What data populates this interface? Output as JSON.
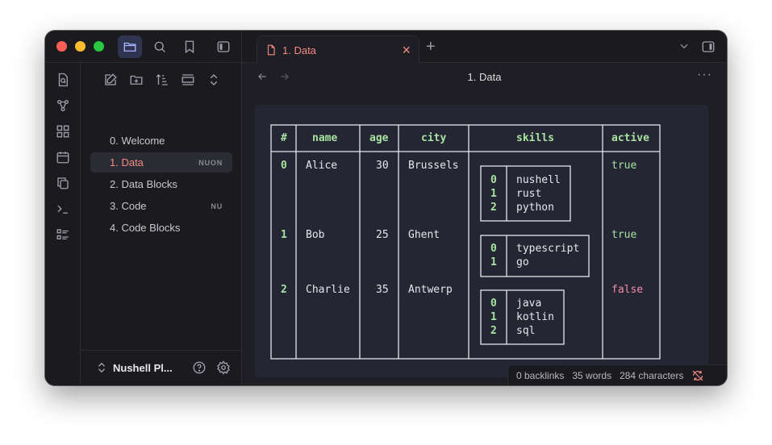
{
  "tab": {
    "label": "1. Data",
    "close": "×",
    "new": "+"
  },
  "main": {
    "title": "1. Data",
    "more": "···"
  },
  "sidebar": {
    "files": [
      {
        "label": "0. Welcome",
        "tag": ""
      },
      {
        "label": "1. Data",
        "tag": "NUON"
      },
      {
        "label": "2. Data Blocks",
        "tag": ""
      },
      {
        "label": "3. Code",
        "tag": "NU"
      },
      {
        "label": "4. Code Blocks",
        "tag": ""
      }
    ],
    "vault_name": "Nushell Pl..."
  },
  "table": {
    "headers": [
      "#",
      "name",
      "age",
      "city",
      "skills",
      "active"
    ],
    "rows": [
      {
        "index": "0",
        "name": "Alice",
        "age": "30",
        "city": "Brussels",
        "skills": [
          {
            "i": "0",
            "v": "nushell"
          },
          {
            "i": "1",
            "v": "rust"
          },
          {
            "i": "2",
            "v": "python"
          }
        ],
        "active": "true"
      },
      {
        "index": "1",
        "name": "Bob",
        "age": "25",
        "city": "Ghent",
        "skills": [
          {
            "i": "0",
            "v": "typescript"
          },
          {
            "i": "1",
            "v": "go"
          }
        ],
        "active": "true"
      },
      {
        "index": "2",
        "name": "Charlie",
        "age": "35",
        "city": "Antwerp",
        "skills": [
          {
            "i": "0",
            "v": "java"
          },
          {
            "i": "1",
            "v": "kotlin"
          },
          {
            "i": "2",
            "v": "sql"
          }
        ],
        "active": "false"
      }
    ]
  },
  "status": {
    "backlinks": "0 backlinks",
    "words": "35 words",
    "characters": "284 characters"
  },
  "colors": {
    "accent": "#f28b82",
    "header": "#a6e3a1",
    "true": "#a6e3a1",
    "false": "#f38ba8",
    "border": "#e6e6ec"
  }
}
